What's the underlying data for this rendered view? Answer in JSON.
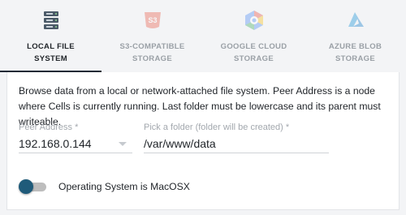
{
  "tabs": [
    {
      "label_line1": "LOCAL FILE",
      "label_line2": "SYSTEM",
      "icon": "server-icon",
      "active": true
    },
    {
      "label_line1": "S3-COMPATIBLE",
      "label_line2": "STORAGE",
      "icon": "s3-icon",
      "active": false
    },
    {
      "label_line1": "GOOGLE CLOUD",
      "label_line2": "STORAGE",
      "icon": "google-cloud-icon",
      "active": false
    },
    {
      "label_line1": "AZURE BLOB",
      "label_line2": "STORAGE",
      "icon": "azure-icon",
      "active": false
    }
  ],
  "description": "Browse data from a local or network-attached file system. Peer Address is a node where Cells is currently running. Last folder must be lowercase and its parent must writeable.",
  "peer_address": {
    "label": "Peer Address *",
    "value": "192.168.0.144"
  },
  "folder": {
    "label": "Pick a folder (folder will be created) *",
    "value": "/var/www/data"
  },
  "os_toggle": {
    "label": "Operating System is MacOSX"
  },
  "colors": {
    "accent": "#1f5b7a",
    "ink_bar": "#1d2a36",
    "s3": "#e8513b",
    "azure": "#0089d6"
  }
}
